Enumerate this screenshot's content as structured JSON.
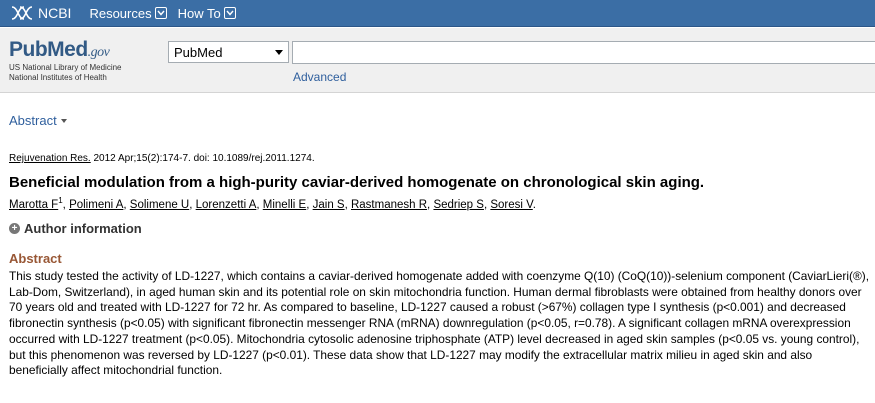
{
  "ncbi_bar": {
    "logo_text": "NCBI",
    "menus": [
      {
        "label": "Resources"
      },
      {
        "label": "How To"
      }
    ]
  },
  "header": {
    "logo": {
      "pub": "Pub",
      "med": "Med",
      "gov": ".gov",
      "nlm_line1": "US National Library of Medicine",
      "nlm_line2": "National Institutes of Health"
    },
    "database_select": "PubMed",
    "search_value": "",
    "advanced_label": "Advanced"
  },
  "format": {
    "label": "Abstract"
  },
  "article": {
    "journal": "Rejuvenation Res.",
    "citation_rest": " 2012 Apr;15(2):174-7. doi: 10.1089/rej.2011.1274.",
    "title": "Beneficial modulation from a high-purity caviar-derived homogenate on chronological skin aging.",
    "authors": [
      {
        "name": "Marotta F",
        "sup": "1"
      },
      {
        "name": "Polimeni A"
      },
      {
        "name": "Solimene U"
      },
      {
        "name": "Lorenzetti A"
      },
      {
        "name": "Minelli E"
      },
      {
        "name": "Jain S"
      },
      {
        "name": "Rastmanesh R"
      },
      {
        "name": "Sedriep S"
      },
      {
        "name": "Soresi V"
      }
    ],
    "author_info_label": "Author information",
    "abstract_heading": "Abstract",
    "abstract_text": "This study tested the activity of LD-1227, which contains a caviar-derived homogenate added with coenzyme Q(10) (CoQ(10))-selenium component (CaviarLieri(®), Lab-Dom, Switzerland), in aged human skin and its potential role on skin mitochondria function. Human dermal fibroblasts were obtained from healthy donors over 70 years old and treated with LD-1227 for 72 hr. As compared to baseline, LD-1227 caused a robust (>67%) collagen type I synthesis (p<0.001) and decreased fibronectin synthesis (p<0.05) with significant fibronectin messenger RNA (mRNA) downregulation (p<0.05, r=0.78). A significant collagen mRNA overexpression occurred with LD-1227 treatment (p<0.05). Mitochondria cytosolic adenosine triphosphate (ATP) level decreased in aged skin samples (p<0.05 vs. young control), but this phenomenon was reversed by LD-1227 (p<0.01). These data show that LD-1227 may modify the extracellular matrix milieu in aged skin and also beneficially affect mitochondrial function."
  },
  "colors": {
    "top_bar": "#3b6ea5",
    "link": "#2f5f9d",
    "abstract_heading": "#985735"
  }
}
